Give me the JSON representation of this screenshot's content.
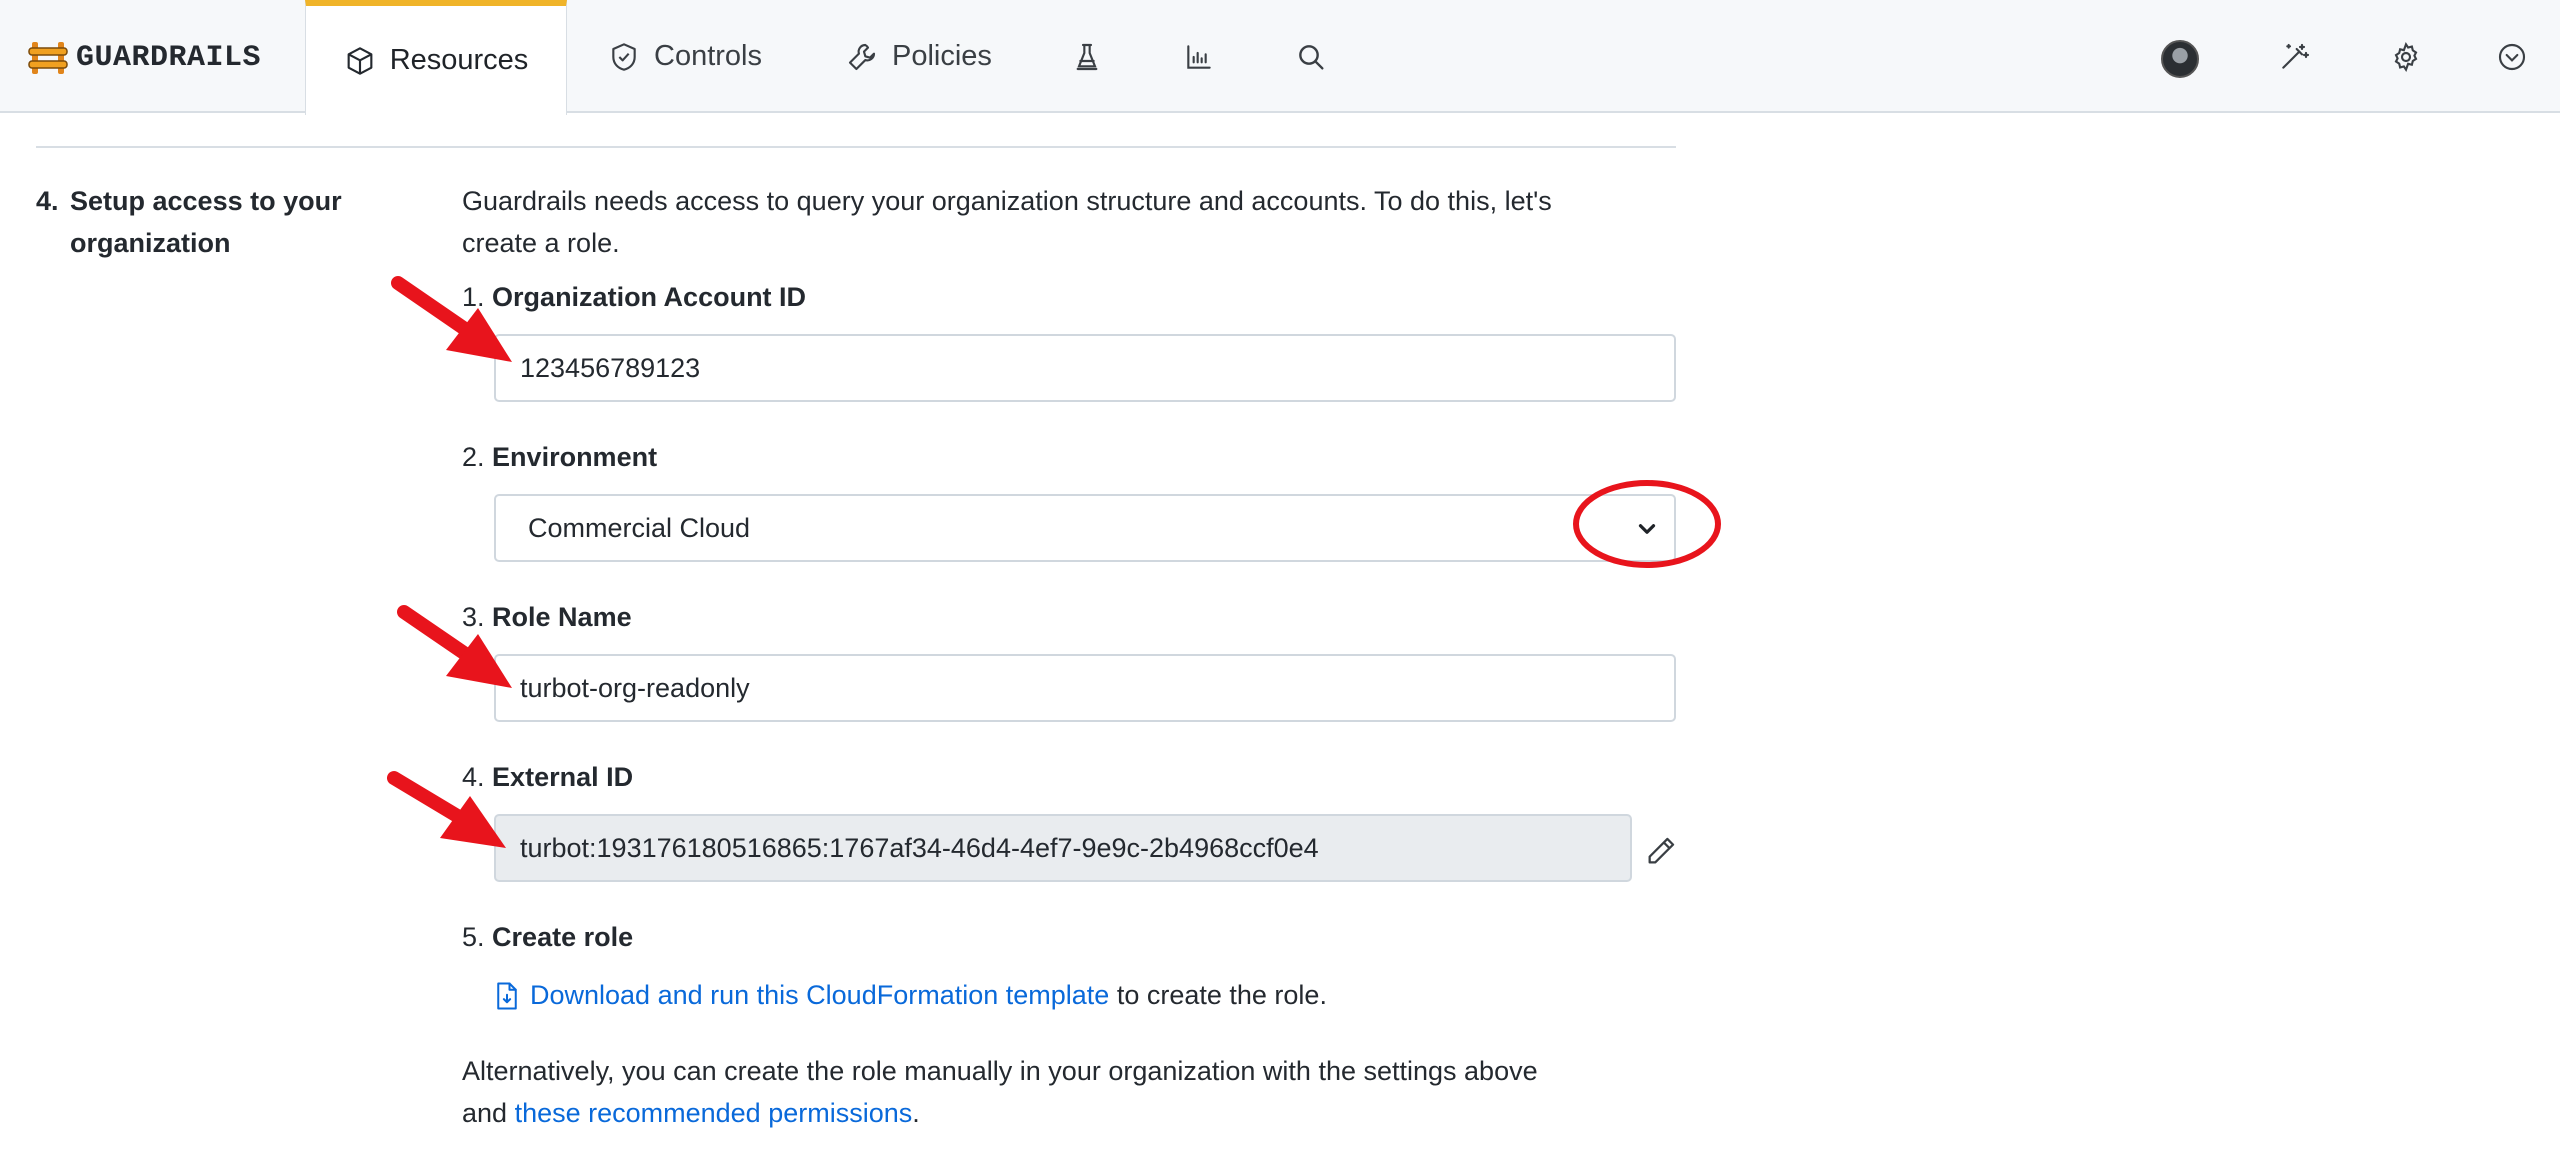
{
  "nav": {
    "brand": "GUARDRAILS",
    "tabs": [
      {
        "label": "Resources",
        "icon": "cube-icon",
        "active": true
      },
      {
        "label": "Controls",
        "icon": "shield-check-icon",
        "active": false
      },
      {
        "label": "Policies",
        "icon": "wrench-icon",
        "active": false
      }
    ],
    "extra_icons": [
      "flask-icon",
      "bar-chart-icon",
      "search-icon"
    ],
    "right_icons": [
      "avatar",
      "magic-wand-icon",
      "gear-icon",
      "chevron-down-circle-icon"
    ],
    "accent_color": "#f0b429"
  },
  "step": {
    "number": "4.",
    "title_line1": "Setup access to your",
    "title_line2": "organization",
    "intro_line1": "Guardrails needs access to query your organization structure and accounts. To do this, let's",
    "intro_line2": "create a role."
  },
  "fields": {
    "org_account": {
      "num": "1.",
      "label": "Organization Account ID",
      "value": "123456789123"
    },
    "environment": {
      "num": "2.",
      "label": "Environment",
      "value": "Commercial Cloud"
    },
    "role_name": {
      "num": "3.",
      "label": "Role Name",
      "value": "turbot-org-readonly"
    },
    "external_id": {
      "num": "4.",
      "label": "External ID",
      "value": "turbot:193176180516865:1767af34-46d4-4ef7-9e9c-2b4968ccf0e4"
    },
    "create_role": {
      "num": "5.",
      "label": "Create role"
    }
  },
  "create_role": {
    "link_text": "Download and run this CloudFormation template",
    "suffix": " to create the role."
  },
  "alternative": {
    "line1": "Alternatively, you can create the role manually in your organization with the settings above",
    "prefix2": "and ",
    "link_text": "these recommended permissions",
    "suffix2": "."
  },
  "colors": {
    "link": "#0969da",
    "annotation": "#e8141c"
  }
}
